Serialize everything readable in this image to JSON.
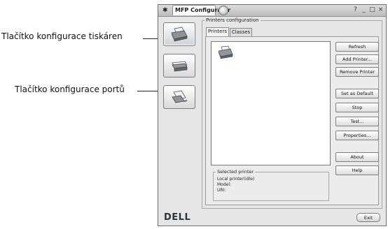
{
  "callouts": {
    "printers_button": "Tlačítko konfigurace tiskáren",
    "ports_button": "Tlačítko konfigurace portů"
  },
  "window": {
    "title": "MFP Configurator",
    "controls": [
      "?",
      "_",
      "□",
      "×"
    ]
  },
  "sidebar": {
    "items": [
      {
        "name": "printers-config",
        "icon": "printer-icon",
        "active": true
      },
      {
        "name": "scanners-config",
        "icon": "scanner-icon",
        "active": false
      },
      {
        "name": "ports-config",
        "icon": "port-icon",
        "active": false
      }
    ]
  },
  "printers_config": {
    "group_label": "Printers configuration",
    "tabs": [
      "Printers",
      "Classes"
    ],
    "active_tab": "Printers",
    "buttons": [
      "Refresh",
      "Add Printer...",
      "Remove Printer",
      "Set as Default",
      "Stop",
      "Test...",
      "Properties...",
      "About",
      "Help"
    ]
  },
  "selected_printer": {
    "label": "Selected printer",
    "lines": [
      "Local printer(idle)",
      "Model:",
      "URI:"
    ]
  },
  "footer": {
    "logo": "DELL",
    "exit_label": "Exit"
  }
}
